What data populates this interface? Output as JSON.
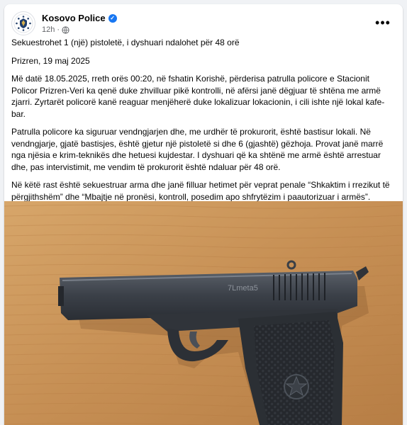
{
  "post": {
    "author": "Kosovo Police",
    "time": "12h",
    "more_icon": "more-dots-icon",
    "verified_icon": "verified-badge-icon",
    "audience_icon": "globe-icon",
    "paragraphs": [
      "Sekuestrohet 1 (një) pistoletë, i dyshuari ndalohet për 48 orë",
      "Prizren, 19 maj 2025",
      "Më datë 18.05.2025, rreth orës 00:20, në fshatin Korishë, përderisa patrulla policore e Stacionit Policor Prizren-Veri ka qenë duke zhvilluar pikë kontrolli, në afërsi janë dëgjuar të shtëna me armë zjarri. Zyrtarët policorë kanë reaguar menjëherë duke lokalizuar lokacionin, i cili ishte një lokal kafe-bar.",
      "Patrulla policore ka siguruar vendngjarjen dhe, me urdhër të prokurorit, është bastisur lokali. Në vendngjarje, gjatë bastisjes, është gjetur një pistoletë si dhe 6 (gjashtë) gëzhoja. Provat janë marrë nga njësia e krim-teknikës dhe hetuesi kujdestar. I dyshuari që ka shtënë me armë është arrestuar dhe, pas intervistimit, me vendim të prokurorit është ndaluar për 48 orë.",
      "Në këtë rast është sekuestruar arma dhe janë filluar hetimet për veprat penale “Shkaktim i rrezikut të përgjithshëm” dhe “Mbajtje në pronësi, kontroll, posedim apo shfrytëzim i paautorizuar i armës”."
    ],
    "photo_engraving": "7Lmeta5"
  },
  "colors": {
    "verified_blue": "#1877f2",
    "meta_gray": "#65676b",
    "wood": "#c9955a",
    "gun_metal": "#3a3f46"
  }
}
